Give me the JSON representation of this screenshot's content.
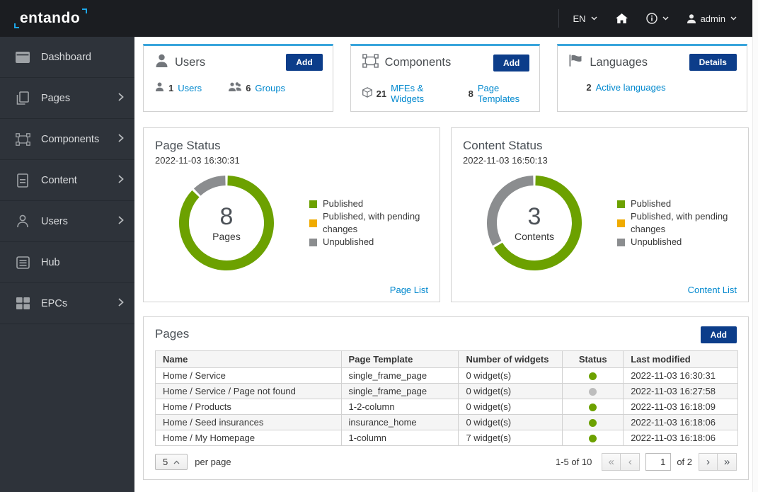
{
  "colors": {
    "accent_card_top": "#39a5dc",
    "link": "#0088ce",
    "primary_button": "#0c3d8a",
    "status_published": "#6ca100",
    "status_pending": "#f0ab00",
    "status_unpublished": "#8b8d8f",
    "table_dot_unpublished": "#bdbdbd"
  },
  "navbar": {
    "logo_text": "entando",
    "language_label": "EN",
    "username": "admin"
  },
  "sidebar": {
    "items": [
      {
        "label": "Dashboard"
      },
      {
        "label": "Pages"
      },
      {
        "label": "Components"
      },
      {
        "label": "Content"
      },
      {
        "label": "Users"
      },
      {
        "label": "Hub"
      },
      {
        "label": "EPCs"
      }
    ]
  },
  "cards": [
    {
      "title": "Users",
      "button": "Add",
      "stats": [
        {
          "value": "1",
          "label": "Users"
        },
        {
          "value": "6",
          "label": "Groups"
        }
      ]
    },
    {
      "title": "Components",
      "button": "Add",
      "stats": [
        {
          "value": "21",
          "label": "MFEs & Widgets"
        },
        {
          "value": "8",
          "label": "Page Templates"
        }
      ]
    },
    {
      "title": "Languages",
      "button": "Details",
      "stats": [
        {
          "value": "2",
          "label": "Active languages"
        }
      ]
    }
  ],
  "chart_data": [
    {
      "type": "pie",
      "variant": "donut",
      "title": "Page Status",
      "timestamp": "2022-11-03 16:30:31",
      "center_value": "8",
      "center_label": "Pages",
      "legend_position": "right",
      "segments": [
        {
          "label": "Published",
          "value": 7,
          "color": "#6ca100"
        },
        {
          "label": "Published, with pending changes",
          "value": 0,
          "color": "#f0ab00"
        },
        {
          "label": "Unpublished",
          "value": 1,
          "color": "#8b8d8f"
        }
      ],
      "footer_link": "Page List"
    },
    {
      "type": "pie",
      "variant": "donut",
      "title": "Content Status",
      "timestamp": "2022-11-03 16:50:13",
      "center_value": "3",
      "center_label": "Contents",
      "legend_position": "right",
      "segments": [
        {
          "label": "Published",
          "value": 2,
          "color": "#6ca100"
        },
        {
          "label": "Published, with pending changes",
          "value": 0,
          "color": "#f0ab00"
        },
        {
          "label": "Unpublished",
          "value": 1,
          "color": "#8b8d8f"
        }
      ],
      "footer_link": "Content List"
    }
  ],
  "pages_table": {
    "title": "Pages",
    "button": "Add",
    "columns": [
      "Name",
      "Page Template",
      "Number of widgets",
      "Status",
      "Last modified"
    ],
    "rows": [
      {
        "name": "Home / Service",
        "template": "single_frame_page",
        "widgets": "0 widget(s)",
        "status": "published",
        "modified": "2022-11-03 16:30:31"
      },
      {
        "name": "Home / Service / Page not found",
        "template": "single_frame_page",
        "widgets": "0 widget(s)",
        "status": "unpublished",
        "modified": "2022-11-03 16:27:58"
      },
      {
        "name": "Home / Products",
        "template": "1-2-column",
        "widgets": "0 widget(s)",
        "status": "published",
        "modified": "2022-11-03 16:18:09"
      },
      {
        "name": "Home / Seed insurances",
        "template": "insurance_home",
        "widgets": "0 widget(s)",
        "status": "published",
        "modified": "2022-11-03 16:18:06"
      },
      {
        "name": "Home / My Homepage",
        "template": "1-column",
        "widgets": "7 widget(s)",
        "status": "published",
        "modified": "2022-11-03 16:18:06"
      }
    ],
    "pagination": {
      "per_page_value": "5",
      "per_page_label": "per page",
      "range_label": "1-5 of 10",
      "current_page": "1",
      "total_label": "of 2",
      "first_icon": "«",
      "prev_icon": "‹",
      "next_icon": "›",
      "last_icon": "»"
    }
  }
}
